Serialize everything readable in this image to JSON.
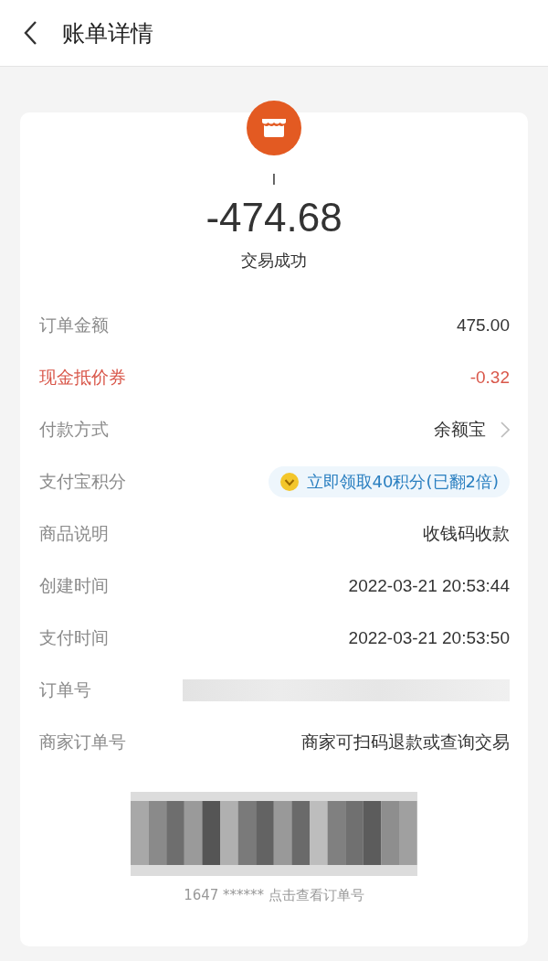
{
  "header": {
    "title": "账单详情"
  },
  "summary": {
    "merchant": "I",
    "amount": "-474.68",
    "status": "交易成功"
  },
  "rows": [
    {
      "kind": "text",
      "label": "订单金额",
      "value": "475.00"
    },
    {
      "kind": "discount",
      "label": "现金抵价券",
      "value": "-0.32"
    },
    {
      "kind": "link",
      "label": "付款方式",
      "value": "余额宝"
    },
    {
      "kind": "points",
      "label": "支付宝积分",
      "value": "立即领取40积分(已翻2倍)"
    },
    {
      "kind": "text",
      "label": "商品说明",
      "value": "收钱码收款"
    },
    {
      "kind": "text",
      "label": "创建时间",
      "value": "2022-03-21 20:53:44"
    },
    {
      "kind": "text",
      "label": "支付时间",
      "value": "2022-03-21 20:53:50"
    },
    {
      "kind": "redacted",
      "label": "订单号"
    },
    {
      "kind": "text",
      "label": "商家订单号",
      "value": "商家可扫码退款或查询交易"
    }
  ],
  "barcode": {
    "caption": "1647 ****** 点击查看订单号"
  }
}
